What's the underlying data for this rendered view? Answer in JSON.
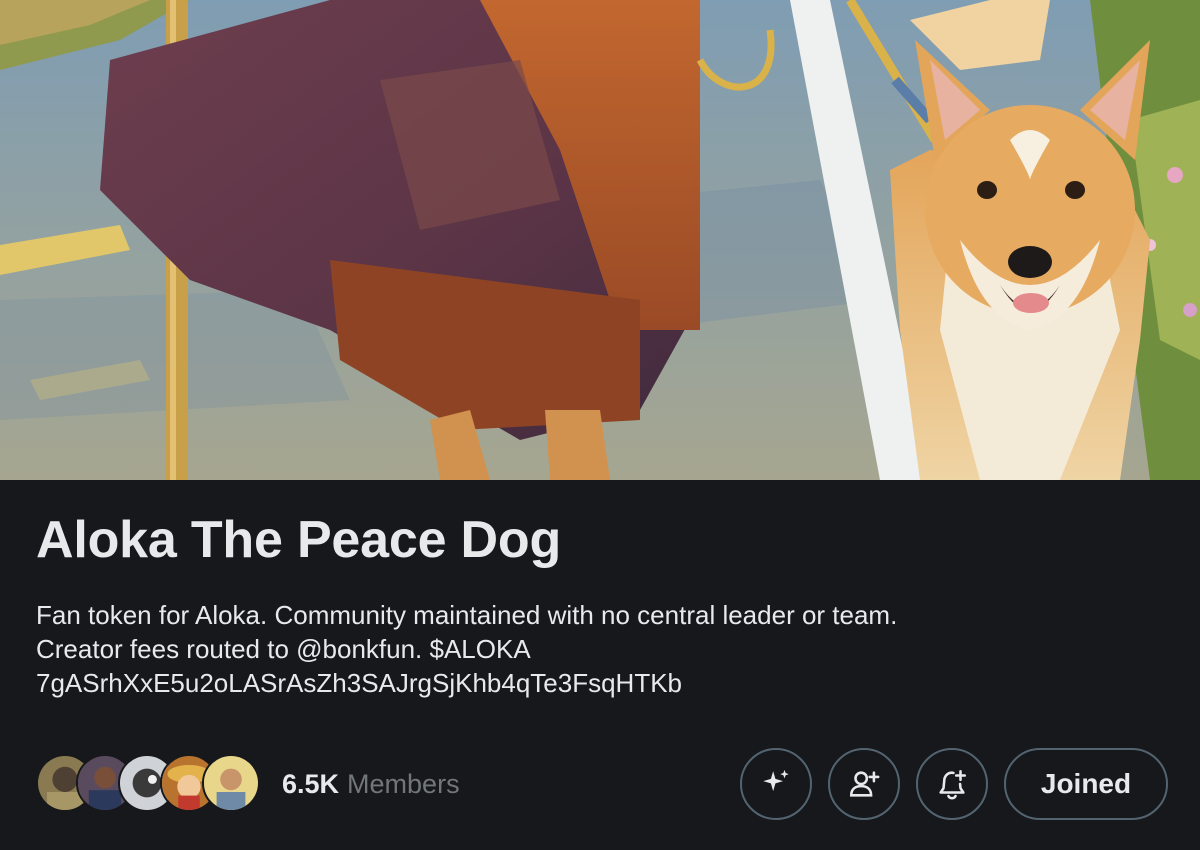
{
  "community": {
    "title": "Aloka The Peace Dog",
    "description_lines": [
      "Fan token for Aloka. Community maintained with no central leader or team.",
      "Creator fees routed to @bonkfun. $ALOKA",
      "7gASrhXxE5u2oLASrAsZh3SAJrgSjKhb4qTe3FsqHTKb"
    ],
    "members_count": "6.5K",
    "members_label": "Members"
  },
  "member_avatars": [
    {
      "name": "avatar-1",
      "color": "#8a7a52"
    },
    {
      "name": "avatar-2",
      "color": "#5a4a5e"
    },
    {
      "name": "avatar-3",
      "color": "#cfd2d6"
    },
    {
      "name": "avatar-4",
      "color": "#b8742e"
    },
    {
      "name": "avatar-5",
      "color": "#e8d68a"
    }
  ],
  "actions": {
    "sparkle_icon": "sparkle-icon",
    "invite_icon": "add-person-icon",
    "notify_icon": "bell-plus-icon",
    "joined_label": "Joined"
  },
  "colors": {
    "background": "#16181c",
    "text_primary": "#e7e9ea",
    "text_secondary": "#71767b",
    "button_border": "#536471"
  }
}
